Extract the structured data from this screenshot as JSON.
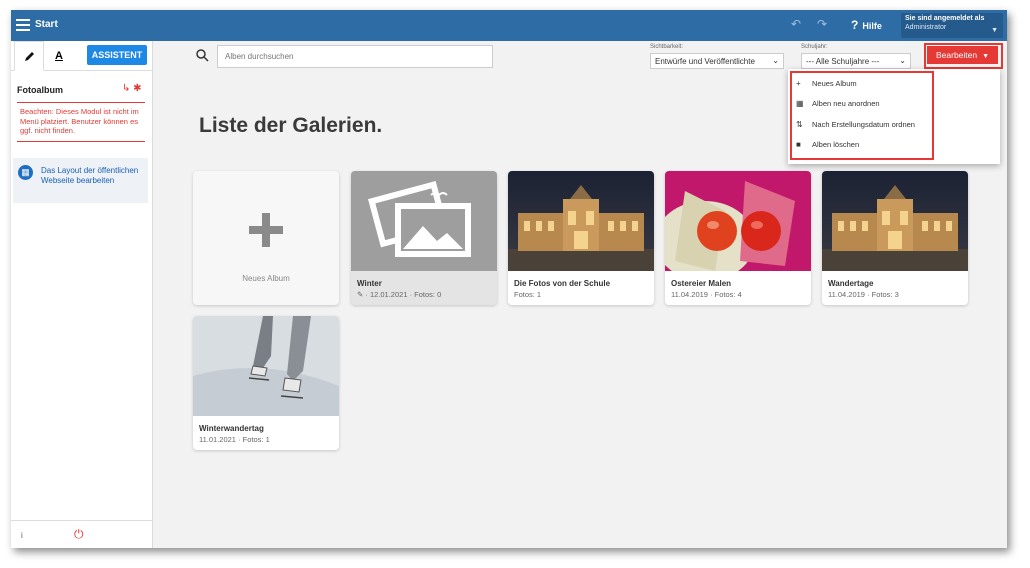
{
  "topbar": {
    "title": "Start",
    "help": "Hilfe",
    "user_line1": "Sie sind angemeldet als",
    "user_line2": "Administrator"
  },
  "sidebar": {
    "tab_text": "A",
    "assistant": "ASSISTENT",
    "module_title": "Fotoalbum",
    "notice_bold": "Beachten:",
    "notice_text": " Dieses Modul ist nicht im Menü platziert. Benutzer können es ggf. nicht finden.",
    "layout_link": "Das Layout der öffentlichen Webseite bearbeiten",
    "info": "i"
  },
  "toolbar": {
    "search_placeholder": "Alben durchsuchen",
    "visibility_label": "Sichtbarkeit:",
    "visibility_value": "Entwürfe und Veröffentlichte",
    "schoolyear_label": "Schuljahr:",
    "schoolyear_value": "--- Alle Schuljahre ---",
    "edit_button": "Bearbeiten"
  },
  "dropdown": {
    "items": [
      {
        "label": "Neues Album",
        "icon": "plus-icon"
      },
      {
        "label": "Alben neu anordnen",
        "icon": "grid-icon"
      },
      {
        "label": "Nach Erstellungsdatum ordnen",
        "icon": "sort-icon"
      },
      {
        "label": "Alben löschen",
        "icon": "trash-icon"
      }
    ]
  },
  "page": {
    "title": "Liste der Galerien."
  },
  "albums": [
    {
      "title": "",
      "meta": "Neues Album"
    },
    {
      "title": "Winter",
      "meta": "· 12.01.2021 · Fotos: 0"
    },
    {
      "title": "Die Fotos von der Schule",
      "meta": "Fotos: 1"
    },
    {
      "title": "Ostereier Malen",
      "meta": "11.04.2019 · Fotos: 4"
    },
    {
      "title": "Wandertage",
      "meta": "11.04.2019 · Fotos: 3"
    },
    {
      "title": "Winterwandertag",
      "meta": "11.01.2021 · Fotos: 1"
    }
  ],
  "colors": {
    "topbar": "#2d6ca5",
    "accent_red": "#e53935",
    "assistant_blue": "#1e88e5"
  }
}
